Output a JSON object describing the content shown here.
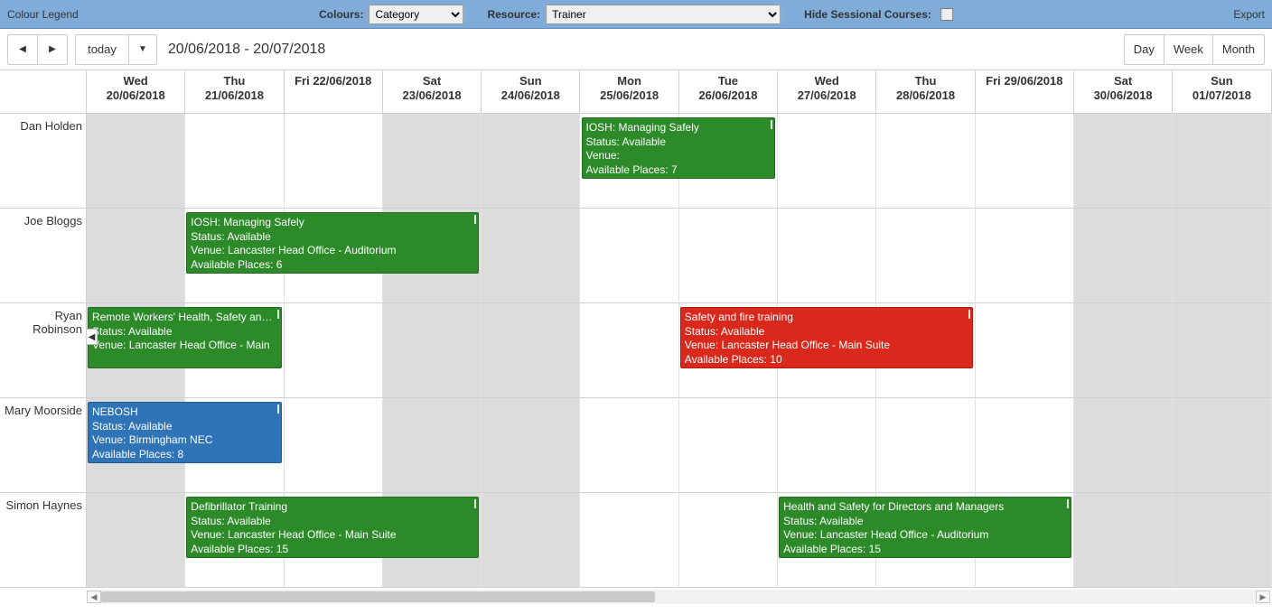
{
  "topbar": {
    "legend_label": "Colour Legend",
    "colours_label": "Colours:",
    "colours_value": "Category",
    "resource_label": "Resource:",
    "resource_value": "Trainer",
    "hide_sessional_label": "Hide Sessional Courses:",
    "export_label": "Export"
  },
  "toolbar": {
    "today_label": "today",
    "date_range": "20/06/2018 - 20/07/2018",
    "views": {
      "day": "Day",
      "week": "Week",
      "month": "Month"
    }
  },
  "columns": [
    {
      "dow": "Wed",
      "date": "20/06/2018",
      "weekend": true
    },
    {
      "dow": "Thu",
      "date": "21/06/2018",
      "weekend": false
    },
    {
      "dow": "Fri",
      "short": true,
      "date": "Fri 22/06/2018",
      "weekend": false
    },
    {
      "dow": "Sat",
      "date": "23/06/2018",
      "weekend": true
    },
    {
      "dow": "Sun",
      "date": "24/06/2018",
      "weekend": true
    },
    {
      "dow": "Mon",
      "date": "25/06/2018",
      "weekend": false
    },
    {
      "dow": "Tue",
      "date": "26/06/2018",
      "weekend": false
    },
    {
      "dow": "Wed",
      "date": "27/06/2018",
      "weekend": false
    },
    {
      "dow": "Thu",
      "date": "28/06/2018",
      "weekend": false
    },
    {
      "dow": "Fri",
      "short": true,
      "date": "Fri 29/06/2018",
      "weekend": false
    },
    {
      "dow": "Sat",
      "date": "30/06/2018",
      "weekend": true
    },
    {
      "dow": "Sun",
      "date": "01/07/2018",
      "weekend": true
    }
  ],
  "resources": [
    "Dan Holden",
    "Joe Bloggs",
    "Ryan Robinson",
    "Mary Moorside",
    "Simon Haynes"
  ],
  "events": [
    {
      "row": 0,
      "startCol": 5,
      "span": 2,
      "color": "green",
      "title": "IOSH: Managing Safely",
      "status": "Status: Available",
      "venue": "Venue:",
      "places": "Available Places: 7"
    },
    {
      "row": 1,
      "startCol": 1,
      "span": 3,
      "color": "green",
      "title": "IOSH: Managing Safely",
      "status": "Status: Available",
      "venue": "Venue: Lancaster Head Office - Auditorium",
      "places": "Available Places: 6"
    },
    {
      "row": 2,
      "startCol": 0,
      "span": 2,
      "color": "green",
      "continuesLeft": true,
      "title": "Remote Workers' Health, Safety and Welfare",
      "status": "Status: Available",
      "venue": "Venue: Lancaster Head Office - Main",
      "places": ""
    },
    {
      "row": 2,
      "startCol": 6,
      "span": 3,
      "color": "red",
      "title": "Safety and fire training",
      "status": "Status: Available",
      "venue": "Venue: Lancaster Head Office - Main Suite",
      "places": "Available Places: 10"
    },
    {
      "row": 3,
      "startCol": 0,
      "span": 2,
      "color": "blue",
      "title": "NEBOSH",
      "status": "Status: Available",
      "venue": "Venue: Birmingham NEC",
      "places": "Available Places: 8"
    },
    {
      "row": 4,
      "startCol": 1,
      "span": 3,
      "color": "green",
      "title": "Defibrillator Training",
      "status": "Status: Available",
      "venue": "Venue: Lancaster Head Office - Main Suite",
      "places": "Available Places: 15"
    },
    {
      "row": 4,
      "startCol": 7,
      "span": 3,
      "color": "green",
      "title": "Health and Safety for Directors and Managers",
      "status": "Status: Available",
      "venue": "Venue: Lancaster Head Office - Auditorium",
      "places": "Available Places: 15"
    }
  ]
}
